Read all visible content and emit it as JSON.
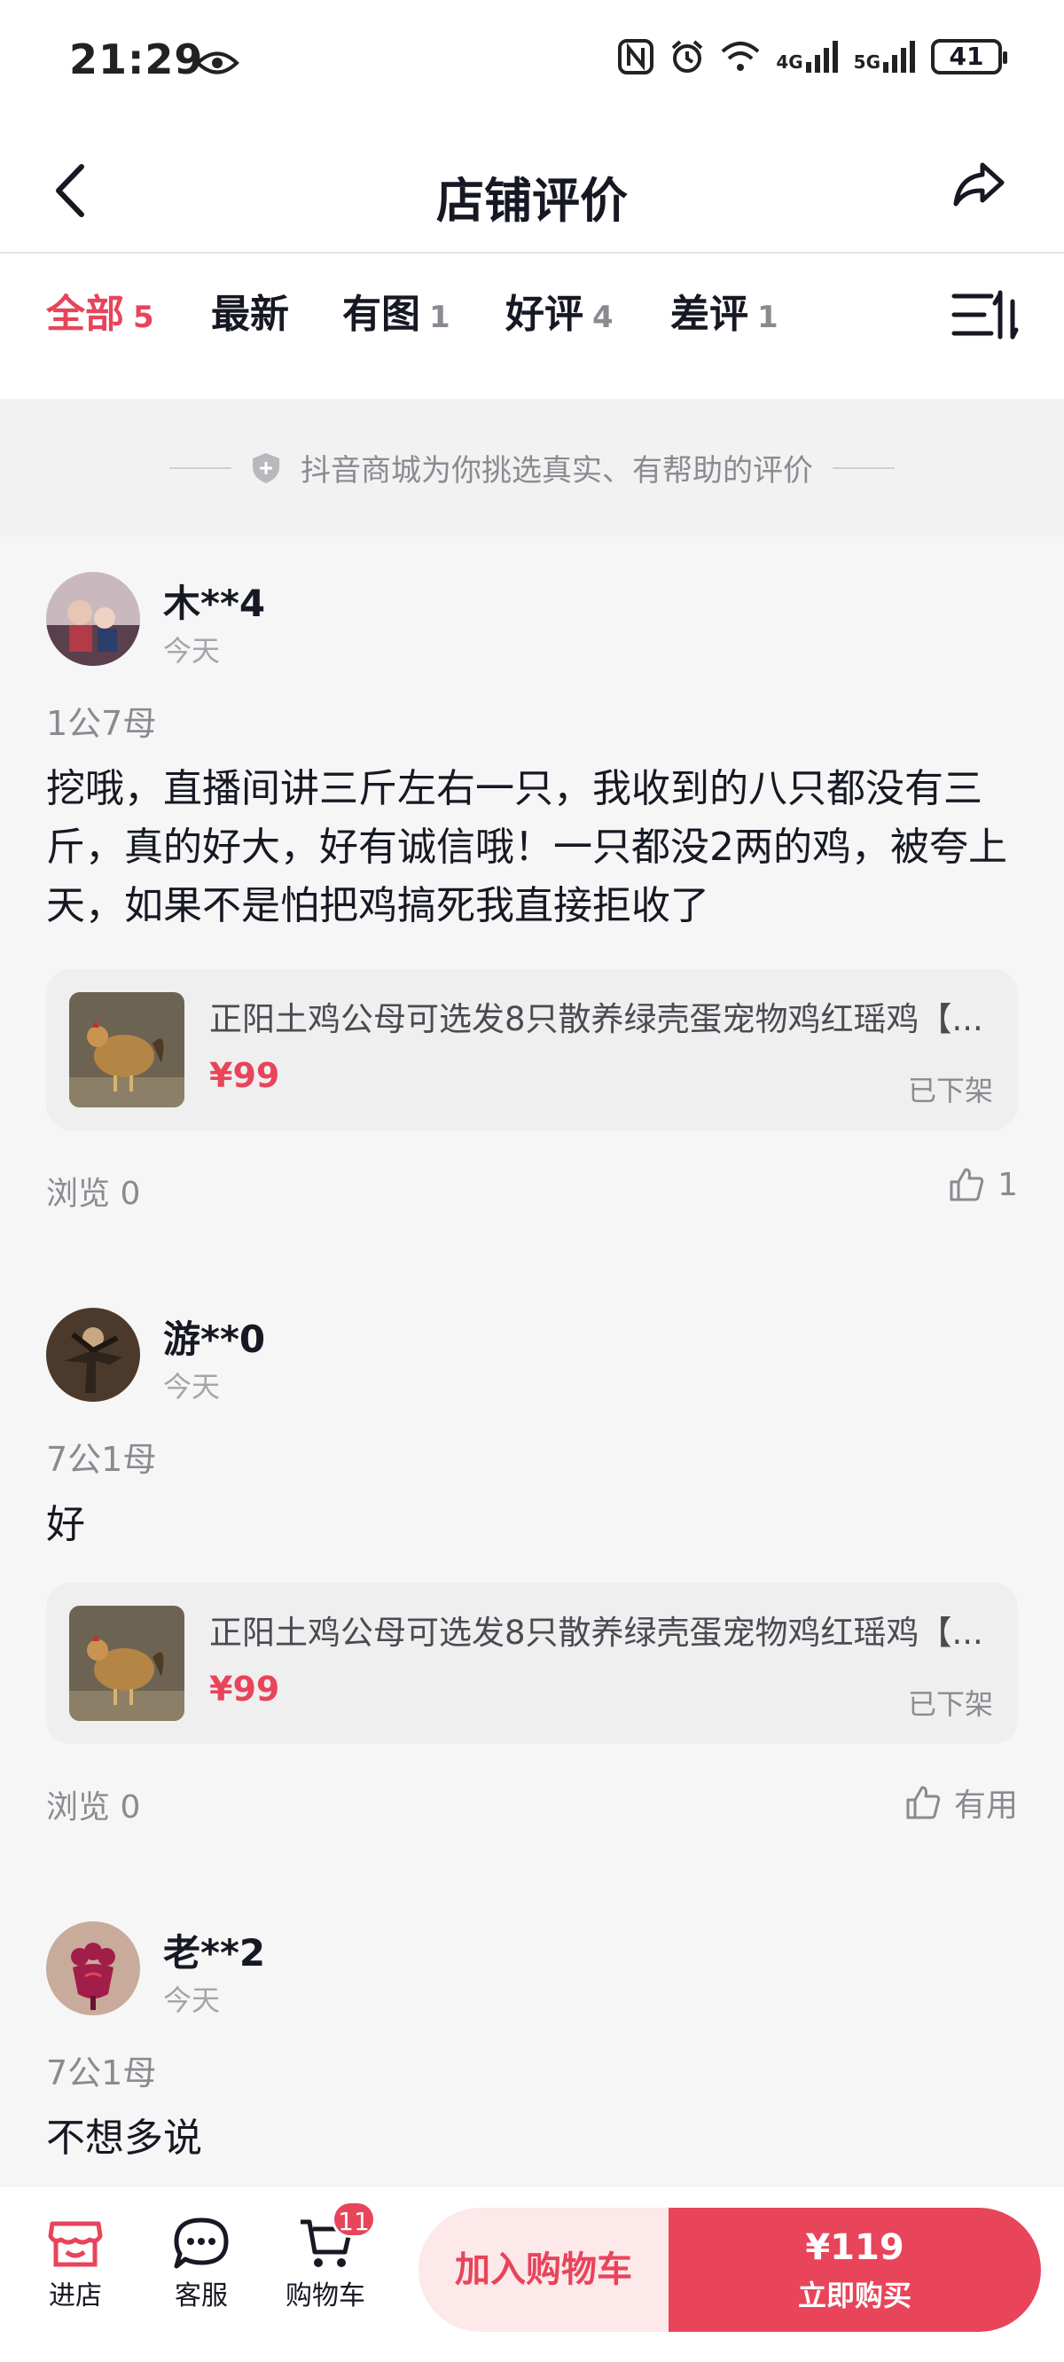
{
  "status_bar": {
    "time": "21:29",
    "sig1": "4G",
    "sig2": "5G",
    "battery": "41"
  },
  "header": {
    "title": "店铺评价"
  },
  "tabs": [
    {
      "label": "全部",
      "count": "5"
    },
    {
      "label": "最新",
      "count": ""
    },
    {
      "label": "有图",
      "count": "1"
    },
    {
      "label": "好评",
      "count": "4"
    },
    {
      "label": "差评",
      "count": "1"
    }
  ],
  "notice": "抖音商城为你挑选真实、有帮助的评价",
  "reviews": [
    {
      "user": "木**4",
      "date": "今天",
      "spec": "1公7母",
      "content": "挖哦，直播间讲三斤左右一只，我收到的八只都没有三斤，真的好大，好有诚信哦！一只都没2两的鸡，被夸上天，如果不是怕把鸡搞死我直接拒收了",
      "product": {
        "title": "正阳土鸡公母可选发8只散养绿壳蛋宠物鸡红瑶鸡【...",
        "price": "¥99",
        "status": "已下架"
      },
      "views": "浏览 0",
      "likes": "1"
    },
    {
      "user": "游**0",
      "date": "今天",
      "spec": "7公1母",
      "content": "好",
      "product": {
        "title": "正阳土鸡公母可选发8只散养绿壳蛋宠物鸡红瑶鸡【...",
        "price": "¥99",
        "status": "已下架"
      },
      "views": "浏览 0",
      "likes": "有用"
    },
    {
      "user": "老**2",
      "date": "今天",
      "spec": "7公1母",
      "content": "不想多说"
    }
  ],
  "bottom_bar": {
    "shop": "进店",
    "service": "客服",
    "cart": "购物车",
    "cart_badge": "11",
    "add_to_cart": "加入购物车",
    "price": "¥119",
    "buy_now": "立即购买"
  },
  "colors": {
    "accent": "#e8445a",
    "text": "#161823",
    "muted": "#8a8b91"
  }
}
